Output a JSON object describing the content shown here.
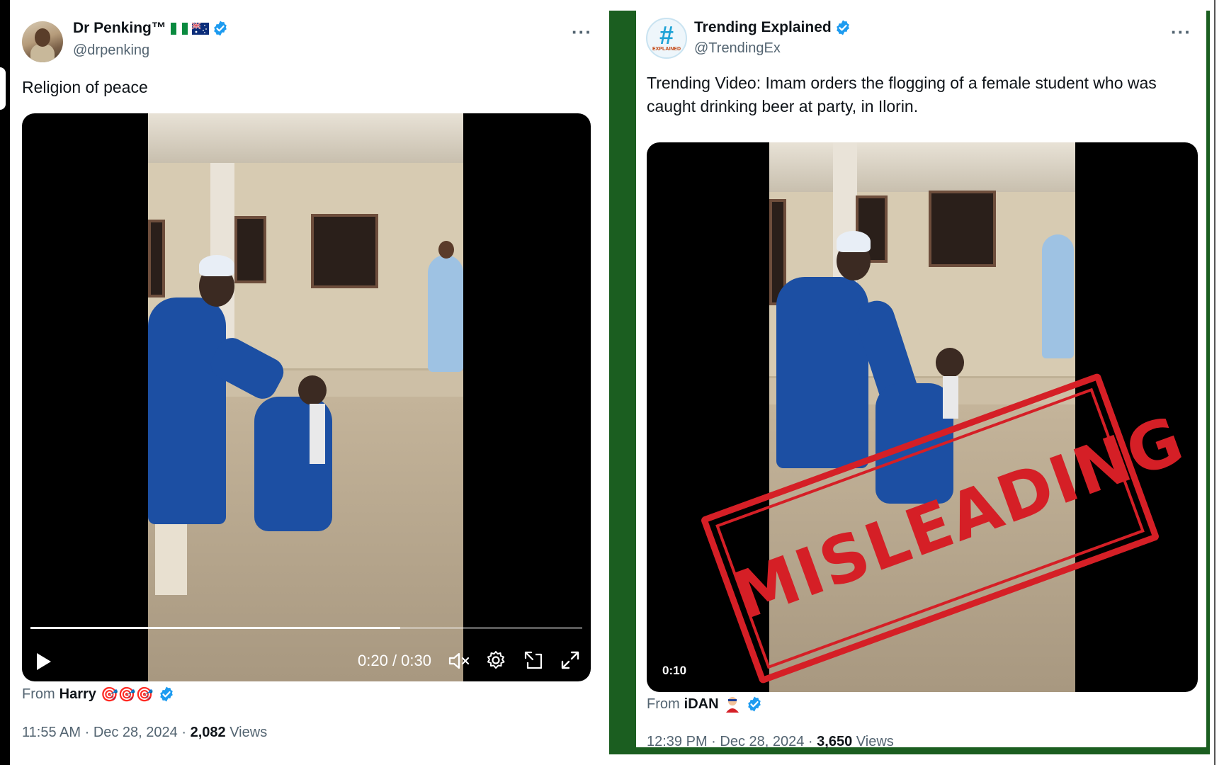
{
  "left_tweet": {
    "display_name": "Dr Penking™",
    "handle": "@drpenking",
    "more_label": "···",
    "text": "Religion of peace",
    "video": {
      "current_time": "0:20",
      "separator": " / ",
      "total_time": "0:30",
      "progress_fraction": 0.67
    },
    "byline_prefix": "From",
    "byline_name": "Harry",
    "byline_emoji": "🎯🎯🎯",
    "time": "11:55 AM",
    "date": "Dec 28, 2024",
    "views_count": "2,082",
    "views_label": "Views"
  },
  "right_tweet": {
    "display_name": "Trending Explained",
    "handle": "@TrendingEx",
    "more_label": "···",
    "avatar_symbol": "#",
    "avatar_caption": "EXPLAINED",
    "text": "Trending Video: Imam orders the flogging of a female student who was caught drinking beer at party, in Ilorin.",
    "video": {
      "duration": "0:10"
    },
    "stamp_text": "MISLEADING",
    "byline_prefix": "From",
    "byline_name": "iDAN",
    "time": "12:39 PM",
    "date": "Dec 28, 2024",
    "views_count": "3,650",
    "views_label": "Views"
  },
  "colors": {
    "verified": "#1d9bf0",
    "green_frame": "#1b5e20",
    "stamp_red": "#d51f26",
    "secondary_text": "#536471"
  }
}
